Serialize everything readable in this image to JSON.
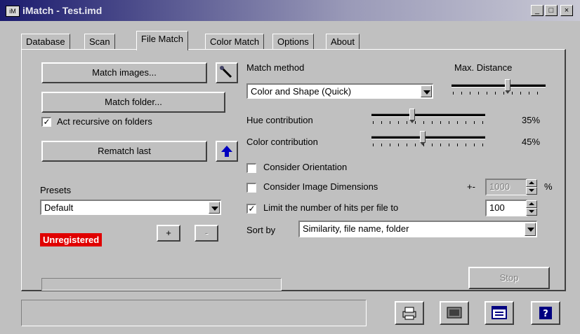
{
  "window": {
    "title": "iMatch - Test.imd"
  },
  "tabs": [
    {
      "label": "Database"
    },
    {
      "label": "Scan"
    },
    {
      "label": "File Match"
    },
    {
      "label": "Color Match"
    },
    {
      "label": "Options"
    },
    {
      "label": "About"
    }
  ],
  "left": {
    "match_images": "Match images...",
    "match_folder": "Match folder...",
    "act_recursive": "Act recursive on folders",
    "act_recursive_checked": true,
    "rematch_last": "Rematch last",
    "presets_label": "Presets",
    "presets_value": "Default",
    "plus": "+",
    "minus": "-",
    "unregistered": "Unregistered"
  },
  "right": {
    "match_method_label": "Match method",
    "match_method_value": "Color and Shape (Quick)",
    "max_distance_label": "Max. Distance",
    "max_distance_level": 0.6,
    "hue_label": "Hue contribution",
    "hue_value": "35%",
    "hue_level": 0.35,
    "color_label": "Color contribution",
    "color_value": "45%",
    "color_level": 0.45,
    "consider_orientation": "Consider Orientation",
    "consider_orientation_checked": false,
    "consider_dimensions": "Consider Image Dimensions",
    "consider_dimensions_checked": false,
    "plusminus": "+-",
    "dimensions_value": "1000",
    "percent": "%",
    "limit_hits": "Limit the number of hits per file to",
    "limit_hits_checked": true,
    "limit_value": "100",
    "sort_label": "Sort by",
    "sort_value": "Similarity, file name, folder",
    "stop": "Stop"
  },
  "statusbar": {
    "text": ""
  }
}
